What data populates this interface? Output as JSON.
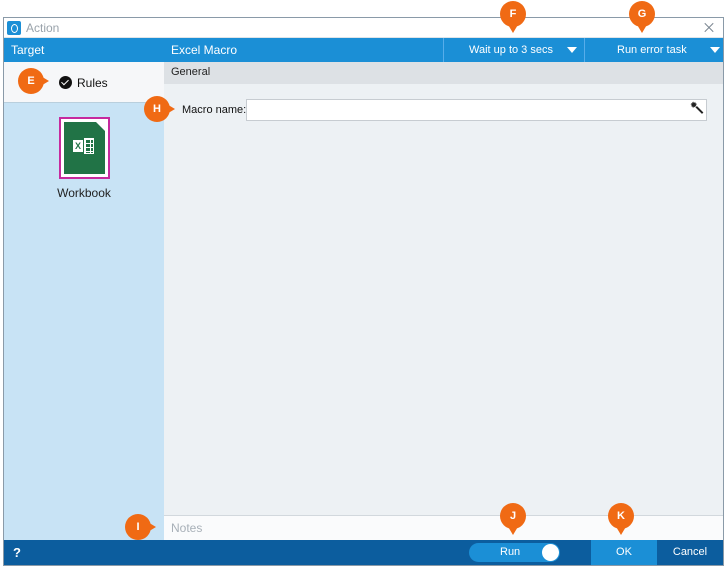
{
  "window": {
    "title": "Action",
    "app_icon": "app-logo-icon",
    "close_icon": "close-icon"
  },
  "left_pane": {
    "header": "Target",
    "rules_label": "Rules",
    "rules_icon": "check-circle-icon",
    "target_item": {
      "label": "Workbook",
      "icon": "excel-icon"
    }
  },
  "main": {
    "title": "Excel Macro",
    "wait_dropdown": "Wait up to 3 secs",
    "error_dropdown": "Run error task",
    "section": "General",
    "macro_name_label": "Macro name:",
    "macro_name_value": "",
    "picker_icon": "magic-wand-icon",
    "notes_placeholder": "Notes"
  },
  "footer": {
    "help": "?",
    "run_label": "Run",
    "ok_label": "OK",
    "cancel_label": "Cancel"
  },
  "callouts": {
    "E": "E",
    "F": "F",
    "G": "G",
    "H": "H",
    "I": "I",
    "J": "J",
    "K": "K"
  },
  "colors": {
    "accent": "#1b8fd6",
    "footer": "#0c5d9e",
    "callout": "#f06a14",
    "left_pane": "#c8e3f5",
    "selection": "#c62a9e",
    "excel": "#217346"
  }
}
